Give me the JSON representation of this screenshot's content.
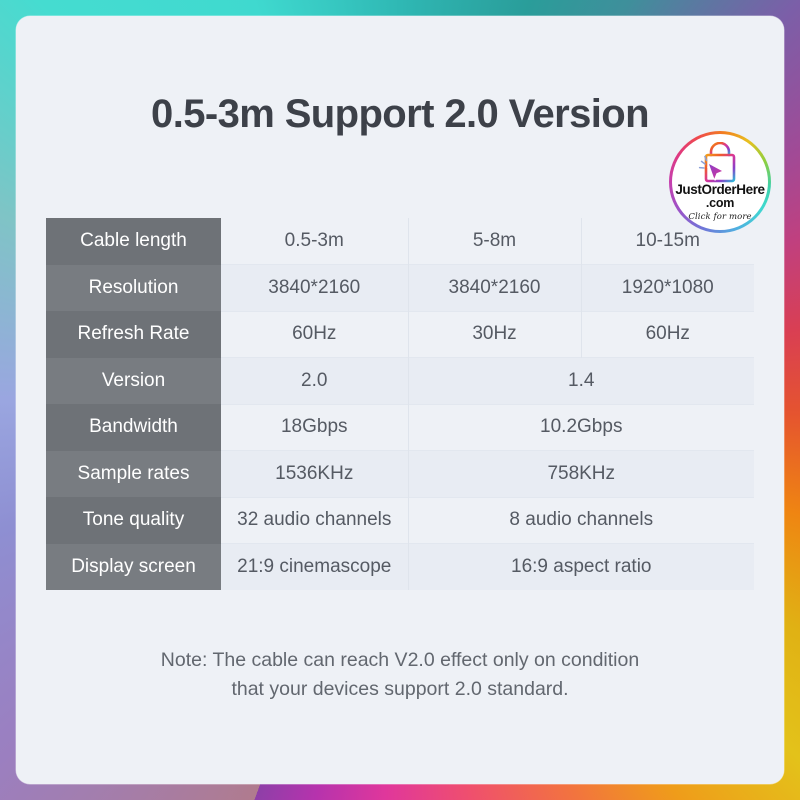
{
  "header": {
    "title": "0.5-3m Support 2.0 Version"
  },
  "logo": {
    "icon": "shopping-bag-cursor-icon",
    "name": "JustOrderHere",
    "tld": ".com",
    "cta": "Click for more"
  },
  "table": {
    "rows": [
      {
        "label": "Cable length",
        "cells": [
          {
            "text": "0.5-3m",
            "span": 1
          },
          {
            "text": "5-8m",
            "span": 1
          },
          {
            "text": "10-15m",
            "span": 1
          }
        ]
      },
      {
        "label": "Resolution",
        "cells": [
          {
            "text": "3840*2160",
            "span": 1
          },
          {
            "text": "3840*2160",
            "span": 1
          },
          {
            "text": "1920*1080",
            "span": 1
          }
        ]
      },
      {
        "label": "Refresh Rate",
        "cells": [
          {
            "text": "60Hz",
            "span": 1
          },
          {
            "text": "30Hz",
            "span": 1
          },
          {
            "text": "60Hz",
            "span": 1
          }
        ]
      },
      {
        "label": "Version",
        "cells": [
          {
            "text": "2.0",
            "span": 1
          },
          {
            "text": "1.4",
            "span": 2
          }
        ]
      },
      {
        "label": "Bandwidth",
        "cells": [
          {
            "text": "18Gbps",
            "span": 1
          },
          {
            "text": "10.2Gbps",
            "span": 2
          }
        ]
      },
      {
        "label": "Sample rates",
        "cells": [
          {
            "text": "1536KHz",
            "span": 1
          },
          {
            "text": "758KHz",
            "span": 2
          }
        ]
      },
      {
        "label": "Tone quality",
        "cells": [
          {
            "text": "32 audio channels",
            "span": 1
          },
          {
            "text": "8 audio channels",
            "span": 2
          }
        ]
      },
      {
        "label": "Display screen",
        "cells": [
          {
            "text": "21:9 cinemascope",
            "span": 1
          },
          {
            "text": "16:9 aspect ratio",
            "span": 2
          }
        ]
      }
    ]
  },
  "note": {
    "line1": "Note: The cable can reach V2.0 effect only on condition",
    "line2": "that your devices support 2.0 standard."
  },
  "colors": {
    "card_background": "#eef1f6",
    "label_cell": "#6e7277",
    "label_cell_alt": "#787c81",
    "value_text": "#555a63",
    "title_text": "#3d4149",
    "note_text": "#62676f"
  }
}
